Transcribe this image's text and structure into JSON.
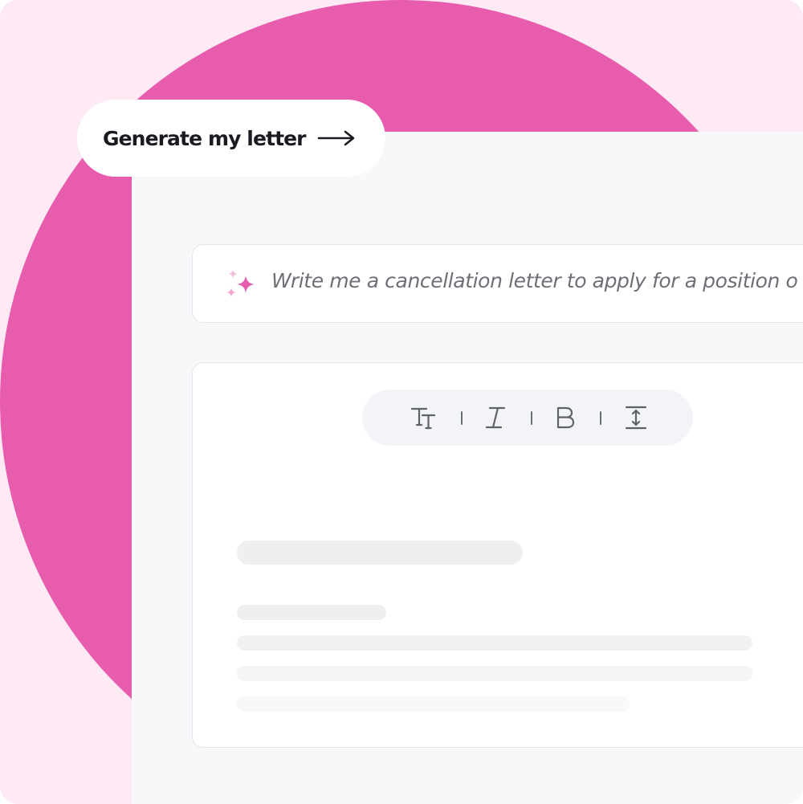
{
  "generate_button": {
    "label": "Generate my letter",
    "icon": "arrow-right-icon"
  },
  "prompt": {
    "icon": "sparkle-icon",
    "text": "Write me a cancellation letter to apply for a position o"
  },
  "toolbar": {
    "tools": [
      {
        "name": "text-size",
        "icon": "text-size-icon"
      },
      {
        "name": "italic",
        "icon": "italic-icon"
      },
      {
        "name": "bold",
        "icon": "bold-icon"
      },
      {
        "name": "line-height",
        "icon": "line-height-icon"
      }
    ]
  },
  "colors": {
    "background": "#fdeaf5",
    "accent": "#e75cad",
    "panel": "#f7f8fa",
    "placeholder_bar": "#eeeff1",
    "placeholder_bar_faint": "#f7f7f8"
  }
}
